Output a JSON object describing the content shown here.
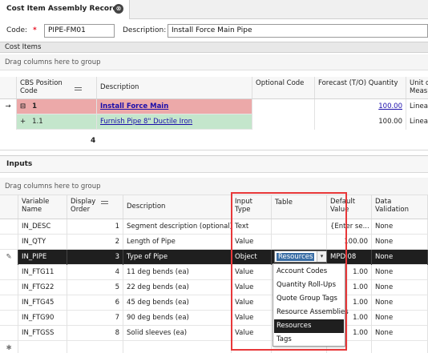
{
  "tab": {
    "title": "Cost Item Assembly Record",
    "close_glyph": "⊗"
  },
  "header": {
    "code_label": "Code:",
    "required_mark": "*",
    "code_value": "PIPE-FM01",
    "description_label": "Description:",
    "description_value": "Install Force Main Pipe"
  },
  "cost_items": {
    "section_title": "Cost Items",
    "group_hint": "Drag columns here to group",
    "columns": {
      "cbs": "CBS Position Code",
      "description": "Description",
      "optional_code": "Optional Code",
      "forecast": "Forecast (T/O) Quantity",
      "unit": "Unit of Measu"
    },
    "rows": [
      {
        "indicator": "→",
        "expander": "⊟",
        "cbs": "1",
        "description": "Install Force Main",
        "optional_code": "",
        "forecast": "100.00",
        "unit": "Linear"
      },
      {
        "indicator": "",
        "expander": "+",
        "cbs": "1.1",
        "description": "Furnish Pipe 8\" Ductile Iron",
        "optional_code": "",
        "forecast": "100.00",
        "unit": "Linear"
      }
    ],
    "footer_count": "4"
  },
  "inputs": {
    "section_title": "Inputs",
    "group_hint": "Drag columns here to group",
    "columns": {
      "variable": "Variable Name",
      "display_order": "Display Order",
      "description": "Description",
      "input_type": "Input Type",
      "table": "Table",
      "default_value": "Default Value",
      "data_validation": "Data Validation"
    },
    "rows": [
      {
        "name": "IN_DESC",
        "order": "1",
        "description": "Segment description (optional)",
        "type": "Text",
        "table": "",
        "default": "{Enter se...",
        "validation": "None"
      },
      {
        "name": "IN_QTY",
        "order": "2",
        "description": "Length of Pipe",
        "type": "Value",
        "table": "",
        "default": "100.00",
        "validation": "None"
      },
      {
        "name": "IN_PIPE",
        "order": "3",
        "description": "Type of Pipe",
        "type": "Object",
        "table": "Resources",
        "default": "MPDI08",
        "validation": "None"
      },
      {
        "name": "IN_FTG11",
        "order": "4",
        "description": "11 deg bends (ea)",
        "type": "Value",
        "table": "",
        "default": "1.00",
        "validation": "None"
      },
      {
        "name": "IN_FTG22",
        "order": "5",
        "description": "22 deg bends (ea)",
        "type": "Value",
        "table": "",
        "default": "1.00",
        "validation": "None"
      },
      {
        "name": "IN_FTG45",
        "order": "6",
        "description": "45 deg bends (ea)",
        "type": "Value",
        "table": "",
        "default": "1.00",
        "validation": "None"
      },
      {
        "name": "IN_FTG90",
        "order": "7",
        "description": "90 deg bends (ea)",
        "type": "Value",
        "table": "",
        "default": "1.00",
        "validation": "None"
      },
      {
        "name": "IN_FTGSS",
        "order": "8",
        "description": "Solid sleeves (ea)",
        "type": "Value",
        "table": "",
        "default": "1.00",
        "validation": "None"
      }
    ],
    "edit_indicator": "✎",
    "new_row_indicator": "✱"
  },
  "table_dropdown": {
    "current_value": "Resources",
    "arrow_glyph": "▾",
    "options": [
      "Account Codes",
      "Quantity Roll-Ups",
      "Quote Group Tags",
      "Resource Assemblies",
      "Resources",
      "Tags"
    ],
    "selected_option": "Resources"
  },
  "colors": {
    "parent_row": "#eca9a9",
    "child_row": "#c4e6cc",
    "selected_row": "#1f1f1f",
    "highlight_box": "#e8383a",
    "link": "#1a0dab"
  }
}
